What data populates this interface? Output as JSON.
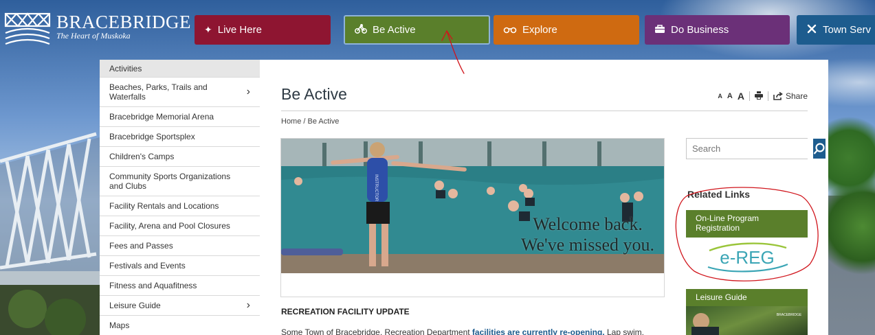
{
  "header": {
    "logo_name": "BRACEBRIDGE",
    "logo_tagline": "The Heart of Muskoka"
  },
  "nav": {
    "items": [
      {
        "label": "Live Here",
        "icon": "family-icon",
        "color": "#8e1531"
      },
      {
        "label": "Be Active",
        "icon": "bicycle-icon",
        "color": "#5a7f2b"
      },
      {
        "label": "Explore",
        "icon": "binoculars-icon",
        "color": "#cf6a11"
      },
      {
        "label": "Do Business",
        "icon": "briefcase-icon",
        "color": "#6b3078"
      },
      {
        "label": "Town Serv",
        "icon": "tools-icon",
        "color": "#1d5c8e"
      }
    ]
  },
  "sidebar": {
    "items": [
      {
        "label": "Activities"
      },
      {
        "label": "Beaches, Parks, Trails and Waterfalls",
        "has_children": true
      },
      {
        "label": "Bracebridge Memorial Arena"
      },
      {
        "label": "Bracebridge Sportsplex"
      },
      {
        "label": "Children's Camps"
      },
      {
        "label": "Community Sports Organizations and Clubs"
      },
      {
        "label": "Facility Rentals and Locations"
      },
      {
        "label": "Facility, Arena and Pool Closures"
      },
      {
        "label": "Fees and Passes"
      },
      {
        "label": "Festivals and Events"
      },
      {
        "label": "Fitness and Aquafitness"
      },
      {
        "label": "Leisure Guide",
        "has_children": true
      },
      {
        "label": "Maps"
      }
    ]
  },
  "main": {
    "title": "Be Active",
    "text_tools": {
      "small": "A",
      "medium": "A",
      "large": "A",
      "share": "Share"
    },
    "breadcrumb": "Home  /  Be Active",
    "hero_caption_line1": "Welcome back.",
    "hero_caption_line2": "We've missed you.",
    "hero_shirt_text": "INSTRUCTOR",
    "update_title": "RECREATION FACILITY UPDATE",
    "update_text_before": "Some Town of Bracebridge, Recreation Department ",
    "update_text_link": "facilities are currently re-opening.",
    "update_text_after": " Lap swim,"
  },
  "right": {
    "search_placeholder": "Search",
    "related_title": "Related Links",
    "card1_label": "On-Line Program Registration",
    "card1_logo": "e-REG",
    "card2_label": "Leisure Guide",
    "card2_badge": "BRACEBRIDGE"
  },
  "colors": {
    "accent_green": "#5a7f2b",
    "accent_blue": "#1d5c8e",
    "annotation_red": "#d0141b"
  }
}
